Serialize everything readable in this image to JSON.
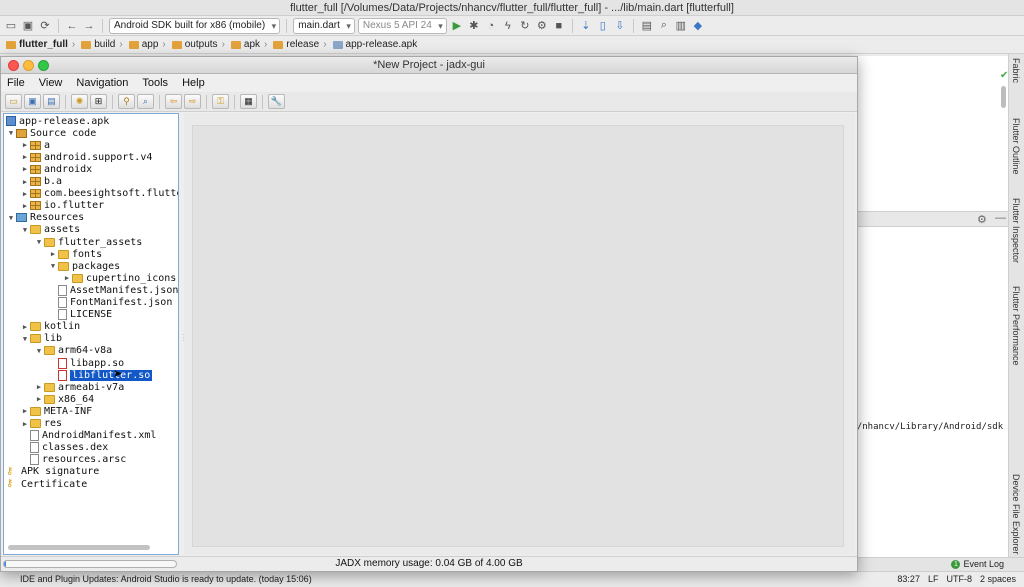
{
  "android_studio": {
    "title": "flutter_full [/Volumes/Data/Projects/nhancv/flutter_full/flutter_full] - .../lib/main.dart [flutterfull]",
    "toolbar": {
      "device_combo": "Android SDK built for x86 (mobile)",
      "config_combo": "main.dart",
      "avd_combo": "Nexus 5 API 24"
    },
    "breadcrumbs": [
      "flutter_full",
      "build",
      "app",
      "outputs",
      "apk",
      "release",
      "app-release.apk"
    ],
    "right_tabs": [
      "Fabric",
      "Flutter Outline",
      "Flutter Inspector",
      "Flutter Performance",
      "Device File Explorer"
    ],
    "sdk_path": "rs/nhancv/Library/Android/sdk",
    "event_log": "Event Log",
    "status": {
      "message": "IDE and Plugin Updates: Android Studio is ready to update. (today 15:06)",
      "position": "83:27",
      "line_sep": "LF",
      "encoding": "UTF-8",
      "indent": "2 spaces"
    }
  },
  "jadx": {
    "title": "*New Project - jadx-gui",
    "menu": [
      "File",
      "View",
      "Navigation",
      "Tools",
      "Help"
    ],
    "memory_label": "JADX memory usage: 0.04 GB of 4.00 GB",
    "memory_fraction": 0.01,
    "tree": [
      {
        "label": "app-release.apk",
        "depth": 0,
        "icon": "apk-icon",
        "arrow": ""
      },
      {
        "label": "Source code",
        "depth": 0,
        "icon": "source-code-icon",
        "arrow": "down"
      },
      {
        "label": "a",
        "depth": 1,
        "icon": "package-icon",
        "arrow": "right"
      },
      {
        "label": "android.support.v4",
        "depth": 1,
        "icon": "package-icon",
        "arrow": "right"
      },
      {
        "label": "androidx",
        "depth": 1,
        "icon": "package-icon",
        "arrow": "right"
      },
      {
        "label": "b.a",
        "depth": 1,
        "icon": "package-icon",
        "arrow": "right"
      },
      {
        "label": "com.beesightsoft.flutte",
        "depth": 1,
        "icon": "package-icon",
        "arrow": "right"
      },
      {
        "label": "io.flutter",
        "depth": 1,
        "icon": "package-icon",
        "arrow": "right"
      },
      {
        "label": "Resources",
        "depth": 0,
        "icon": "resources-icon",
        "arrow": "down"
      },
      {
        "label": "assets",
        "depth": 1,
        "icon": "folder-icon",
        "arrow": "down"
      },
      {
        "label": "flutter_assets",
        "depth": 2,
        "icon": "folder-icon",
        "arrow": "down"
      },
      {
        "label": "fonts",
        "depth": 3,
        "icon": "folder-icon",
        "arrow": "right"
      },
      {
        "label": "packages",
        "depth": 3,
        "icon": "folder-icon",
        "arrow": "down"
      },
      {
        "label": "cupertino_icons",
        "depth": 4,
        "icon": "folder-icon",
        "arrow": "right"
      },
      {
        "label": "AssetManifest.json",
        "depth": 3,
        "icon": "file-icon",
        "arrow": ""
      },
      {
        "label": "FontManifest.json",
        "depth": 3,
        "icon": "file-icon",
        "arrow": ""
      },
      {
        "label": "LICENSE",
        "depth": 3,
        "icon": "file-icon",
        "arrow": ""
      },
      {
        "label": "kotlin",
        "depth": 1,
        "icon": "folder-icon",
        "arrow": "right"
      },
      {
        "label": "lib",
        "depth": 1,
        "icon": "folder-icon",
        "arrow": "down"
      },
      {
        "label": "arm64-v8a",
        "depth": 2,
        "icon": "folder-icon",
        "arrow": "down"
      },
      {
        "label": "libapp.so",
        "depth": 3,
        "icon": "so-file-icon",
        "arrow": ""
      },
      {
        "label": "libflutter.so",
        "depth": 3,
        "icon": "so-file-icon",
        "arrow": "",
        "selected": true
      },
      {
        "label": "armeabi-v7a",
        "depth": 2,
        "icon": "folder-icon",
        "arrow": "right"
      },
      {
        "label": "x86_64",
        "depth": 2,
        "icon": "folder-icon",
        "arrow": "right"
      },
      {
        "label": "META-INF",
        "depth": 1,
        "icon": "folder-icon",
        "arrow": "right"
      },
      {
        "label": "res",
        "depth": 1,
        "icon": "folder-icon",
        "arrow": "right"
      },
      {
        "label": "AndroidManifest.xml",
        "depth": 1,
        "icon": "file-icon",
        "arrow": ""
      },
      {
        "label": "classes.dex",
        "depth": 1,
        "icon": "file-icon",
        "arrow": ""
      },
      {
        "label": "resources.arsc",
        "depth": 1,
        "icon": "file-icon",
        "arrow": ""
      },
      {
        "label": "APK signature",
        "depth": 0,
        "icon": "key-icon",
        "arrow": ""
      },
      {
        "label": "Certificate",
        "depth": 0,
        "icon": "key-icon",
        "arrow": ""
      }
    ]
  }
}
